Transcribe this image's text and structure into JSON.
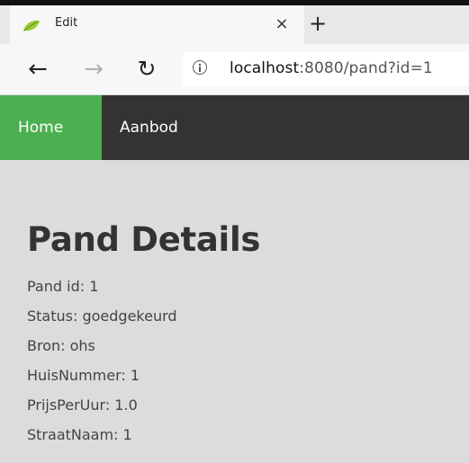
{
  "browser": {
    "tab": {
      "title": "Edit",
      "favicon": "leaf-icon",
      "close_glyph": "×"
    },
    "new_tab_glyph": "+",
    "toolbar": {
      "back_glyph": "←",
      "forward_glyph": "→",
      "reload_glyph": "↻",
      "info_icon": "info-icon",
      "url_host": "localhost",
      "url_rest": ":8080/pand?id=1"
    }
  },
  "navbar": {
    "items": [
      {
        "label": "Home",
        "active": true
      },
      {
        "label": "Aanbod",
        "active": false
      }
    ],
    "active_color": "#4caf50",
    "background_color": "#333333"
  },
  "page": {
    "title": "Pand Details",
    "details": [
      "Pand id: 1",
      "Status: goedgekeurd",
      "Bron: ohs",
      "HuisNummer: 1",
      "PrijsPerUur: 1.0",
      "StraatNaam: 1"
    ]
  }
}
